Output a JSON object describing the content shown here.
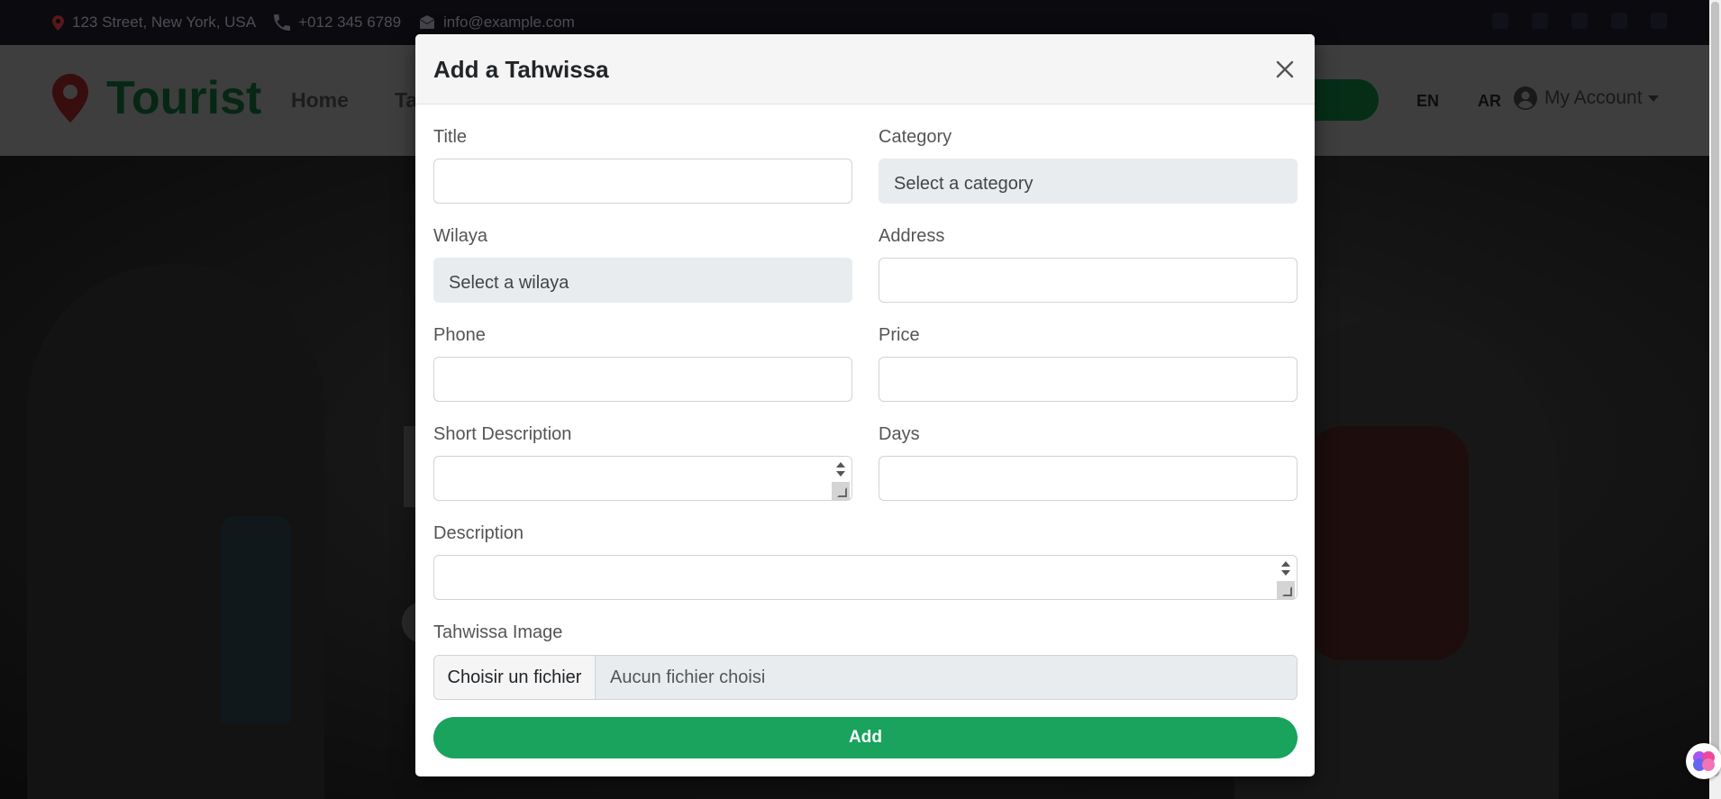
{
  "topbar": {
    "address": "123 Street, New York, USA",
    "phone": "+012 345 6789",
    "email": "info@example.com"
  },
  "navbar": {
    "brand": "Tourist",
    "links": [
      "Home",
      "Ta"
    ],
    "lang_en": "EN",
    "lang_ar": "AR",
    "account_label": "My Account"
  },
  "modal": {
    "title": "Add a Tahwissa",
    "fields": {
      "title_label": "Title",
      "title_value": "",
      "category_label": "Category",
      "category_placeholder": "Select a category",
      "wilaya_label": "Wilaya",
      "wilaya_placeholder": "Select a wilaya",
      "address_label": "Address",
      "address_value": "",
      "phone_label": "Phone",
      "phone_value": "",
      "price_label": "Price",
      "price_value": "",
      "short_description_label": "Short Description",
      "short_description_value": "",
      "days_label": "Days",
      "days_value": "",
      "description_label": "Description",
      "description_value": "",
      "image_label": "Tahwissa Image",
      "file_button": "Choisir un fichier",
      "file_status": "Aucun fichier choisi"
    },
    "submit_label": "Add"
  },
  "colors": {
    "brand_green": "#0e4e2a",
    "submit_green": "#19a35d",
    "select_bg": "#e9ecef"
  }
}
